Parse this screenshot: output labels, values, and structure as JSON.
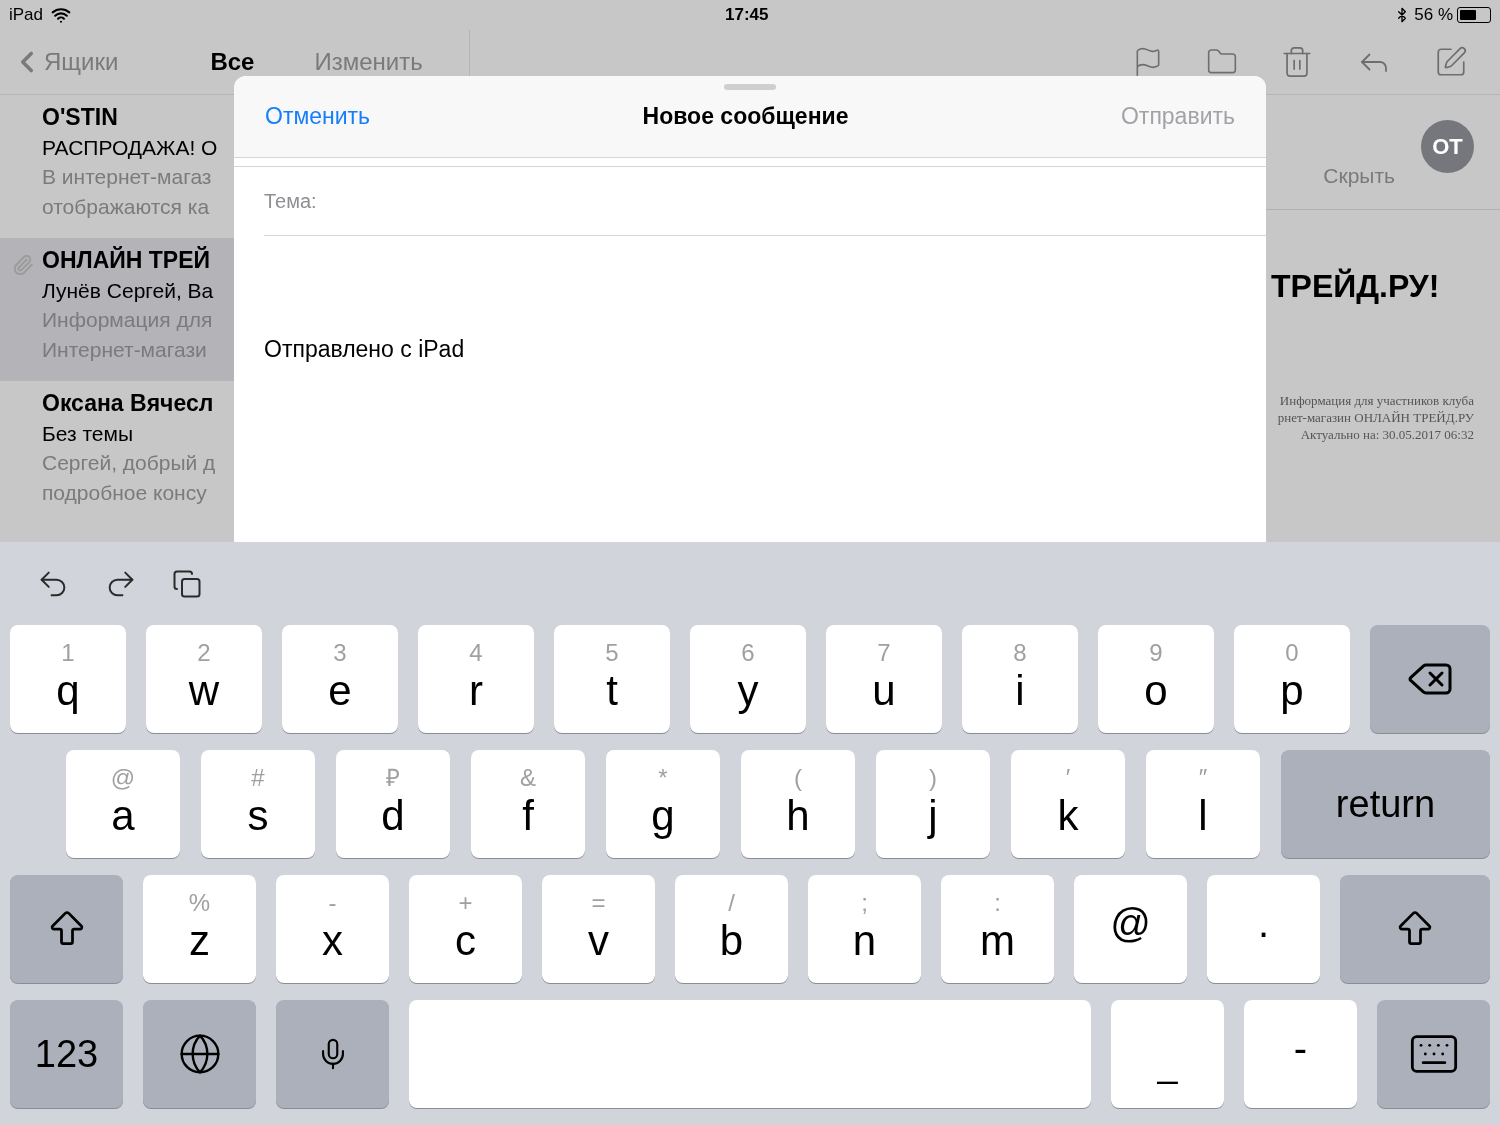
{
  "status_bar": {
    "device": "iPad",
    "time": "17:45",
    "battery": "56 %"
  },
  "nav": {
    "back": "Ящики",
    "title": "Все",
    "edit": "Изменить"
  },
  "messages": [
    {
      "sender": "O'STIN",
      "subject": "РАСПРОДАЖА! О",
      "preview": [
        "В интернет-магаз",
        "отображаются ка"
      ],
      "selected": false,
      "attachment": false
    },
    {
      "sender": "ОНЛАЙН ТРЕЙ",
      "subject": "Лунёв Сергей, Ва",
      "preview": [
        "Информация для",
        "Интернет-магази"
      ],
      "selected": true,
      "attachment": true
    },
    {
      "sender": "Оксана Вячесл",
      "subject": "Без темы",
      "preview": [
        "Сергей, добрый д",
        "подробное консу"
      ],
      "selected": false,
      "attachment": false
    }
  ],
  "reader": {
    "avatar": "ОТ",
    "hide": "Скрыть",
    "heading": "ТРЕЙД.РУ!",
    "info_lines": [
      "Информация для участников клуба",
      "рнет-магазин ОНЛАЙН ТРЕЙД.РУ",
      "Актуально на: 30.05.2017 06:32"
    ]
  },
  "compose": {
    "cancel": "Отменить",
    "title": "Новое сообщение",
    "send": {
      "label": "Отправить",
      "disabled": true
    },
    "subject_label": "Тема:",
    "signature": "Отправлено с iPad"
  },
  "keyboard": {
    "rows": [
      [
        {
          "kind": "letter",
          "label": "q",
          "hint": "1"
        },
        {
          "kind": "letter",
          "label": "w",
          "hint": "2"
        },
        {
          "kind": "letter",
          "label": "e",
          "hint": "3"
        },
        {
          "kind": "letter",
          "label": "r",
          "hint": "4"
        },
        {
          "kind": "letter",
          "label": "t",
          "hint": "5"
        },
        {
          "kind": "letter",
          "label": "y",
          "hint": "6"
        },
        {
          "kind": "letter",
          "label": "u",
          "hint": "7"
        },
        {
          "kind": "letter",
          "label": "i",
          "hint": "8"
        },
        {
          "kind": "letter",
          "label": "o",
          "hint": "9"
        },
        {
          "kind": "letter",
          "label": "p",
          "hint": "0"
        },
        {
          "kind": "backspace"
        }
      ],
      [
        {
          "kind": "letter",
          "label": "a",
          "hint": "@"
        },
        {
          "kind": "letter",
          "label": "s",
          "hint": "#"
        },
        {
          "kind": "letter",
          "label": "d",
          "hint": "₽"
        },
        {
          "kind": "letter",
          "label": "f",
          "hint": "&"
        },
        {
          "kind": "letter",
          "label": "g",
          "hint": "*"
        },
        {
          "kind": "letter",
          "label": "h",
          "hint": "("
        },
        {
          "kind": "letter",
          "label": "j",
          "hint": ")"
        },
        {
          "kind": "letter",
          "label": "k",
          "hint": "′"
        },
        {
          "kind": "letter",
          "label": "l",
          "hint": "″"
        },
        {
          "kind": "return",
          "label": "return"
        }
      ],
      [
        {
          "kind": "shift"
        },
        {
          "kind": "letter",
          "label": "z",
          "hint": "%"
        },
        {
          "kind": "letter",
          "label": "x",
          "hint": "-"
        },
        {
          "kind": "letter",
          "label": "c",
          "hint": "+"
        },
        {
          "kind": "letter",
          "label": "v",
          "hint": "="
        },
        {
          "kind": "letter",
          "label": "b",
          "hint": "/"
        },
        {
          "kind": "letter",
          "label": "n",
          "hint": ";"
        },
        {
          "kind": "letter",
          "label": "m",
          "hint": ":"
        },
        {
          "kind": "char",
          "label": "@"
        },
        {
          "kind": "char",
          "label": "."
        },
        {
          "kind": "shift_right"
        }
      ],
      [
        {
          "kind": "numbers",
          "label": "123"
        },
        {
          "kind": "globe"
        },
        {
          "kind": "mic"
        },
        {
          "kind": "space"
        },
        {
          "kind": "char_low",
          "label": "_"
        },
        {
          "kind": "char",
          "label": "-"
        },
        {
          "kind": "dismiss"
        }
      ]
    ]
  }
}
